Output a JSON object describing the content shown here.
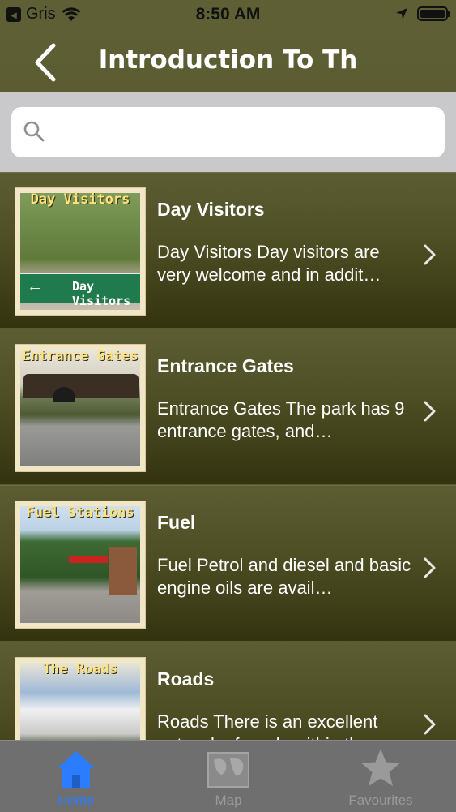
{
  "status_bar": {
    "back_app": "Gris",
    "time": "8:50 AM"
  },
  "nav": {
    "title": "Introduction To Th"
  },
  "search": {
    "placeholder": "",
    "value": ""
  },
  "items": [
    {
      "thumb_caption": "Day Visitors",
      "thumb_sign": "Day Visitors",
      "title": "Day Visitors",
      "description": "Day Visitors Day visitors are very welcome and in addit…"
    },
    {
      "thumb_caption": "Entrance Gates",
      "title": "Entrance Gates",
      "description": "Entrance Gates The park has 9 entrance gates, and…"
    },
    {
      "thumb_caption": "Fuel Stations",
      "title": "Fuel",
      "description": "Fuel Petrol and diesel and basic engine oils are avail…"
    },
    {
      "thumb_caption": "The Roads",
      "title": "Roads",
      "description": "Roads There is an excellent network of roads within th…"
    }
  ],
  "tabs": [
    {
      "label": "Home",
      "icon": "home-icon",
      "active": true
    },
    {
      "label": "Map",
      "icon": "map-icon",
      "active": false
    },
    {
      "label": "Favourites",
      "icon": "star-icon",
      "active": false
    }
  ],
  "colors": {
    "nav_bg": "#5e5f35",
    "active_tab": "#2b7cff",
    "inactive_tab": "#9a9a9a",
    "tabbar_bg": "#6f6f6f"
  }
}
